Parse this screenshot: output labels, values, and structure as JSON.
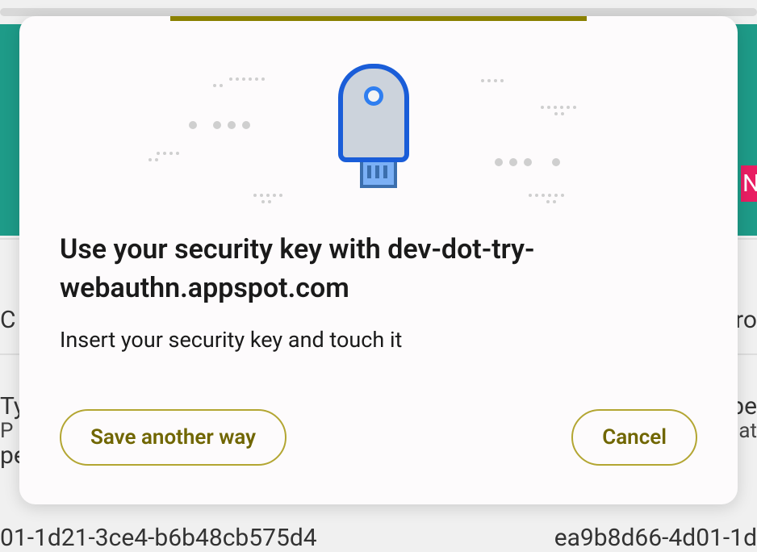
{
  "background": {
    "left_text_1": "C",
    "left_text_2": "Ty",
    "left_text_3": " P",
    "left_text_4": "pe",
    "right_text_1": "ro",
    "right_text_2": "pe",
    "right_text_3": "at",
    "bottom_left": "01-1d21-3ce4-b6b48cb575d4",
    "bottom_right": "ea9b8d66-4d01-1d",
    "pink_label": "N"
  },
  "dialog": {
    "title": "Use your security key with dev-dot-try-webauthn.appspot.com",
    "subtitle": "Insert your security key and touch it",
    "save_another_way_label": "Save another way",
    "cancel_label": "Cancel"
  }
}
